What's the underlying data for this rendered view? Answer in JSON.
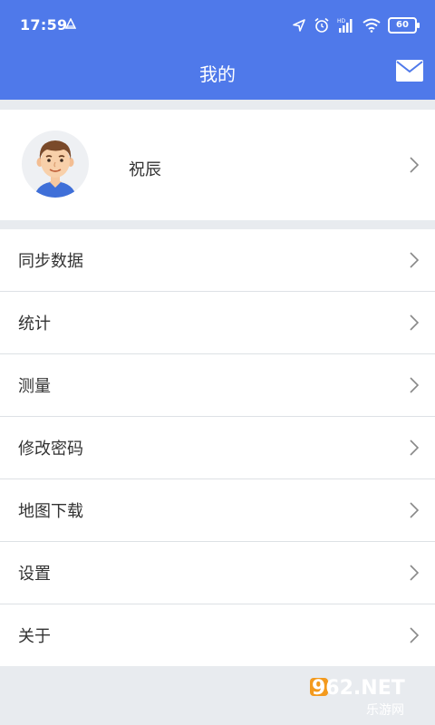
{
  "status": {
    "time": "17:59",
    "battery": "60"
  },
  "header": {
    "title": "我的"
  },
  "profile": {
    "name": "祝辰"
  },
  "menu": [
    {
      "label": "同步数据"
    },
    {
      "label": "统计"
    },
    {
      "label": "测量"
    },
    {
      "label": "修改密码"
    },
    {
      "label": "地图下载"
    },
    {
      "label": "设置"
    },
    {
      "label": "关于"
    }
  ],
  "watermark": {
    "text": "962.NET",
    "sub": "乐游网"
  },
  "colors": {
    "primary": "#4f79ea",
    "background": "#e8ebef",
    "divider": "#dde1e5"
  }
}
